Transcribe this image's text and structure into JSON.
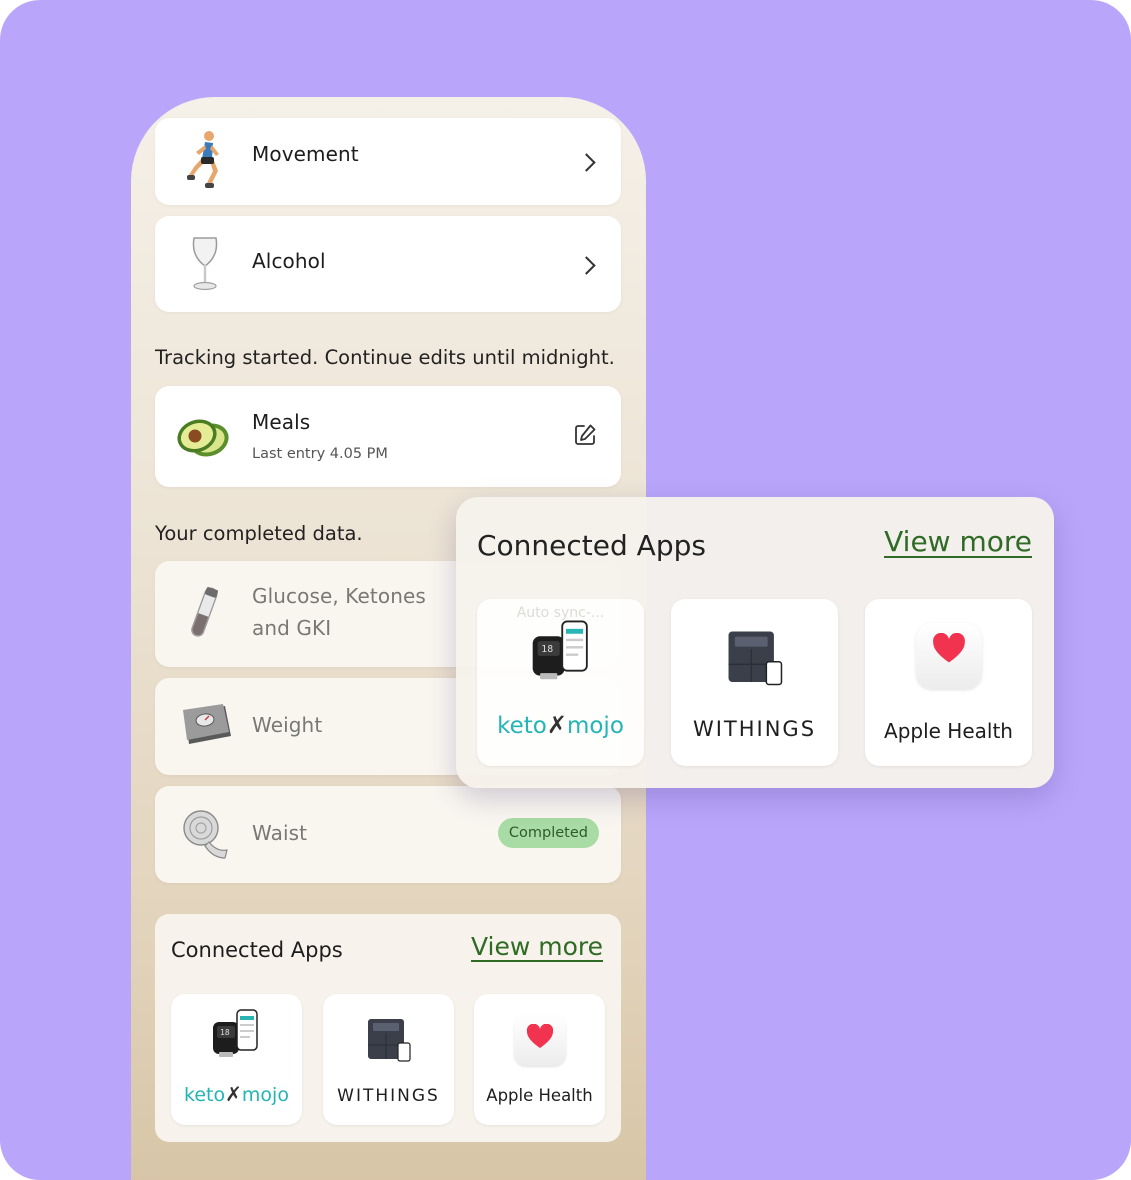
{
  "tracking_items": [
    {
      "label": "Movement",
      "icon": "runner-icon"
    },
    {
      "label": "Alcohol",
      "icon": "wine-glass-icon"
    }
  ],
  "tracking_note": "Tracking started. Continue edits until midnight.",
  "meals": {
    "label": "Meals",
    "subtitle": "Last entry 4.05 PM",
    "icon": "avocado-icon",
    "action_icon": "edit-icon"
  },
  "completed_note": "Your completed data.",
  "completed_items": [
    {
      "label_line1": "Glucose, Ketones",
      "label_line2": "and GKI",
      "icon": "test-tube-icon"
    },
    {
      "label": "Weight",
      "icon": "scale-icon"
    },
    {
      "label": "Waist",
      "icon": "tape-measure-icon",
      "badge": "Completed"
    }
  ],
  "connected_apps": {
    "title": "Connected Apps",
    "view_more": "View more",
    "apps": [
      {
        "name_part1": "keto",
        "name_part2": "mojo",
        "icon": "keto-mojo-device-icon"
      },
      {
        "name": "WITHINGS",
        "icon": "withings-scale-icon"
      },
      {
        "name": "Apple Health",
        "icon": "heart-icon"
      }
    ]
  },
  "overlay": {
    "title": "Connected Apps",
    "view_more": "View more",
    "faded_text": "Auto sync-..."
  },
  "colors": {
    "background": "#b9a6fb",
    "link_green": "#2f6b25",
    "keto_teal": "#23b4b6",
    "badge_green": "#a9dca4",
    "heart_red": "#f2334f"
  }
}
